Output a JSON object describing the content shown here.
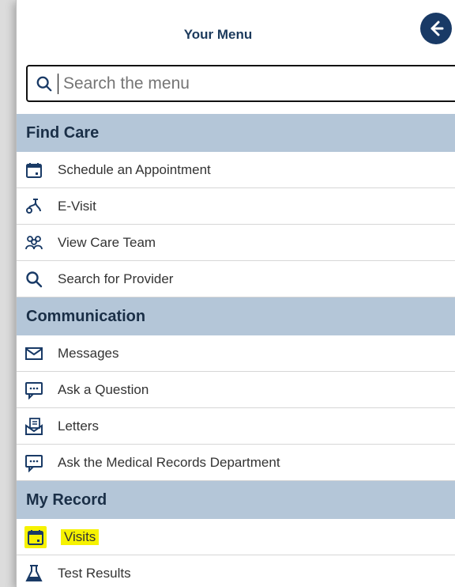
{
  "header": {
    "title": "Your Menu"
  },
  "search": {
    "placeholder": "Search the menu"
  },
  "sections": [
    {
      "label": "Find Care",
      "items": [
        {
          "label": "Schedule an Appointment",
          "icon": "calendar-icon"
        },
        {
          "label": "E-Visit",
          "icon": "stethoscope-icon"
        },
        {
          "label": "View Care Team",
          "icon": "care-team-icon"
        },
        {
          "label": "Search for Provider",
          "icon": "search-icon"
        }
      ]
    },
    {
      "label": "Communication",
      "items": [
        {
          "label": "Messages",
          "icon": "envelope-icon"
        },
        {
          "label": "Ask a Question",
          "icon": "chat-bubble-icon"
        },
        {
          "label": "Letters",
          "icon": "letter-icon"
        },
        {
          "label": "Ask the Medical Records Department",
          "icon": "chat-bubble-icon"
        }
      ]
    },
    {
      "label": "My Record",
      "items": [
        {
          "label": "Visits",
          "icon": "calendar-icon",
          "highlighted": true
        },
        {
          "label": "Test Results",
          "icon": "flask-icon"
        }
      ]
    }
  ],
  "colors": {
    "accent": "#193a66",
    "section_bg": "#b4c6d8",
    "highlight": "#f6f200"
  }
}
